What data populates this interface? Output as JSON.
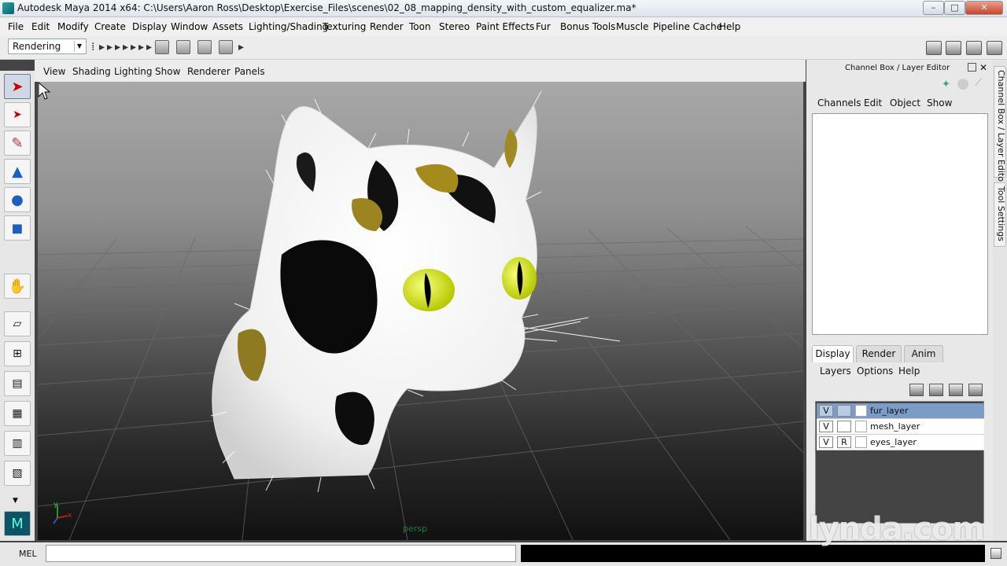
{
  "window": {
    "title": "Autodesk Maya 2014 x64: C:\\Users\\Aaron Ross\\Desktop\\Exercise_Files\\scenes\\02_08_mapping_density_with_custom_equalizer.ma*",
    "min": "–",
    "max": "□",
    "close": "✕"
  },
  "menubar": [
    "File",
    "Edit",
    "Modify",
    "Create",
    "Display",
    "Window",
    "Assets",
    "Lighting/Shading",
    "Texturing",
    "Render",
    "Toon",
    "Stereo",
    "Paint Effects",
    "Fur",
    "Bonus Tools",
    "Muscle",
    "Pipeline Cache",
    "Help"
  ],
  "toolbar": {
    "menuset": "Rendering"
  },
  "panel_menu": [
    "View",
    "Shading",
    "Lighting",
    "Show",
    "Renderer",
    "Panels"
  ],
  "viewport": {
    "camera": "persp",
    "axis_y": "y",
    "axis_x": "x"
  },
  "channel_box": {
    "title": "Channel Box / Layer Editor",
    "menus": [
      "Channels",
      "Edit",
      "Object",
      "Show"
    ]
  },
  "layer_editor": {
    "tabs": [
      "Display",
      "Render",
      "Anim"
    ],
    "active_tab": "Display",
    "menus": [
      "Layers",
      "Options",
      "Help"
    ],
    "layers": [
      {
        "visible": "V",
        "mode": "",
        "name": "fur_layer",
        "selected": true
      },
      {
        "visible": "V",
        "mode": "",
        "name": "mesh_layer",
        "selected": false
      },
      {
        "visible": "V",
        "mode": "R",
        "name": "eyes_layer",
        "selected": false
      }
    ]
  },
  "side_tabs": [
    "Channel Box / Layer Editor",
    "Tool Settings"
  ],
  "command_line": {
    "label": "MEL",
    "input": ""
  },
  "watermark": "lynda.com"
}
